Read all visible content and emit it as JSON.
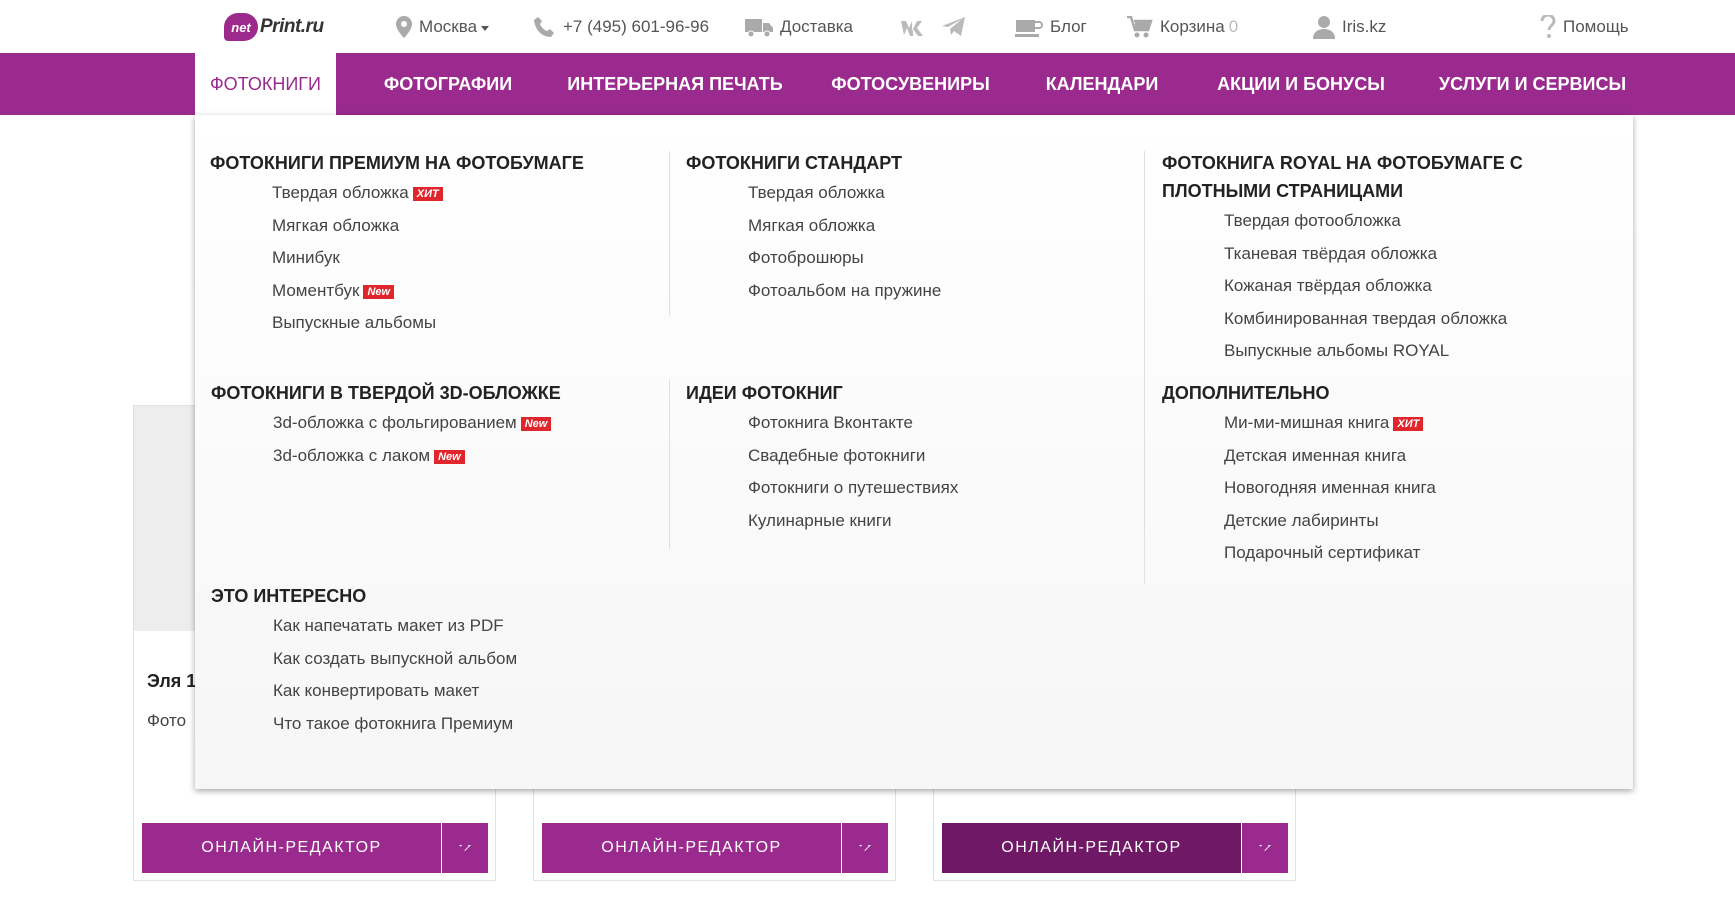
{
  "topbar": {
    "logo_badge": "net",
    "logo_text": "Print.ru",
    "city": "Москва",
    "phone": "+7 (495) 601-96-96",
    "delivery": "Доставка",
    "blog": "Блог",
    "cart": "Корзина",
    "cart_count": "0",
    "account": "Iris.kz",
    "help": "Помощь"
  },
  "nav": {
    "items": [
      {
        "label": "ФОТОКНИГИ"
      },
      {
        "label": "ФОТОГРАФИИ"
      },
      {
        "label": "ИНТЕРЬЕРНАЯ ПЕЧАТЬ"
      },
      {
        "label": "ФОТОСУВЕНИРЫ"
      },
      {
        "label": "КАЛЕНДАРИ"
      },
      {
        "label": "АКЦИИ И БОНУСЫ"
      },
      {
        "label": "УСЛУГИ И СЕРВИСЫ"
      }
    ]
  },
  "menu": {
    "premium": {
      "title": "ФОТОКНИГИ ПРЕМИУМ НА ФОТОБУМАГЕ",
      "items": [
        "Твердая обложка",
        "Мягкая обложка",
        "Минибук",
        "Моментбук",
        "Выпускные альбомы"
      ],
      "badges": [
        "ХИТ",
        "New"
      ]
    },
    "standard": {
      "title": "ФОТОКНИГИ СТАНДАРТ",
      "items": [
        "Твердая обложка",
        "Мягкая обложка",
        "Фотоброшюры",
        "Фотоальбом на пружине"
      ]
    },
    "royal": {
      "title": "ФОТОКНИГА ROYAL НА ФОТОБУМАГЕ С ПЛОТНЫМИ СТРАНИЦАМИ",
      "items": [
        "Твердая фотообложка",
        "Тканевая твёрдая обложка",
        "Кожаная твёрдая обложка",
        "Комбинированная твердая обложка",
        "Выпускные альбомы ROYAL"
      ]
    },
    "cover3d": {
      "title": "ФОТОКНИГИ В ТВЕРДОЙ 3D-ОБЛОЖКЕ",
      "items": [
        "3d-обложка с фольгированием",
        "3d-обложка с лаком"
      ],
      "badges": [
        "New",
        "New"
      ]
    },
    "ideas": {
      "title": "ИДЕИ ФОТОКНИГ",
      "items": [
        "Фотокнига Вконтакте",
        "Свадебные фотокниги",
        "Фотокниги о путешествиях",
        "Кулинарные книги"
      ]
    },
    "extra": {
      "title": "ДОПОЛНИТЕЛЬНО",
      "items": [
        "Ми-ми-мишная книга",
        "Детская именная книга",
        "Новогодняя именная книга",
        "Детские лабиринты",
        "Подарочный сертификат"
      ],
      "badges": [
        "ХИТ"
      ]
    },
    "interesting": {
      "title": "ЭТО ИНТЕРЕСНО",
      "items": [
        "Как напечатать макет из PDF",
        "Как создать выпускной альбом",
        "Как конвертировать макет",
        "Что такое фотокнига Премиум"
      ]
    }
  },
  "cards": {
    "card1": {
      "title": "Эля 1",
      "subtitle": "Фото"
    },
    "button_label": "ОНЛАЙН-РЕДАКТОР"
  },
  "colors": {
    "brand": "#9b2a8e",
    "brand_dark": "#6e1866",
    "badge": "#e0262d"
  }
}
